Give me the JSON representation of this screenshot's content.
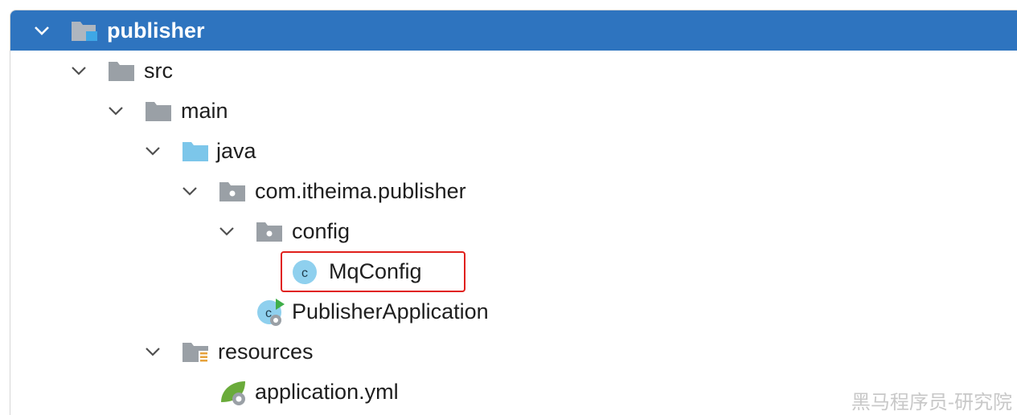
{
  "tree": {
    "root": {
      "label": "publisher",
      "icon": "module-folder-icon",
      "expanded": true
    },
    "src": {
      "label": "src",
      "icon": "folder-icon",
      "expanded": true
    },
    "main": {
      "label": "main",
      "icon": "folder-icon",
      "expanded": true
    },
    "java": {
      "label": "java",
      "icon": "source-root-folder-icon",
      "expanded": true
    },
    "package": {
      "label": "com.itheima.publisher",
      "icon": "package-icon",
      "expanded": true
    },
    "config": {
      "label": "config",
      "icon": "package-icon",
      "expanded": true
    },
    "mqconfig": {
      "label": "MqConfig",
      "icon": "java-class-icon",
      "highlighted": true
    },
    "app": {
      "label": "PublisherApplication",
      "icon": "spring-boot-app-icon"
    },
    "resources": {
      "label": "resources",
      "icon": "resources-folder-icon",
      "expanded": true
    },
    "yml": {
      "label": "application.yml",
      "icon": "spring-config-icon"
    }
  },
  "watermark": "黑马程序员-研究院",
  "colors": {
    "selection": "#2e74bf",
    "highlight_border": "#e0201b",
    "folder_gray": "#9aa0a6",
    "source_blue": "#7cc6ea",
    "class_blue": "#8fd0ee",
    "spring_green": "#6aab3a"
  }
}
